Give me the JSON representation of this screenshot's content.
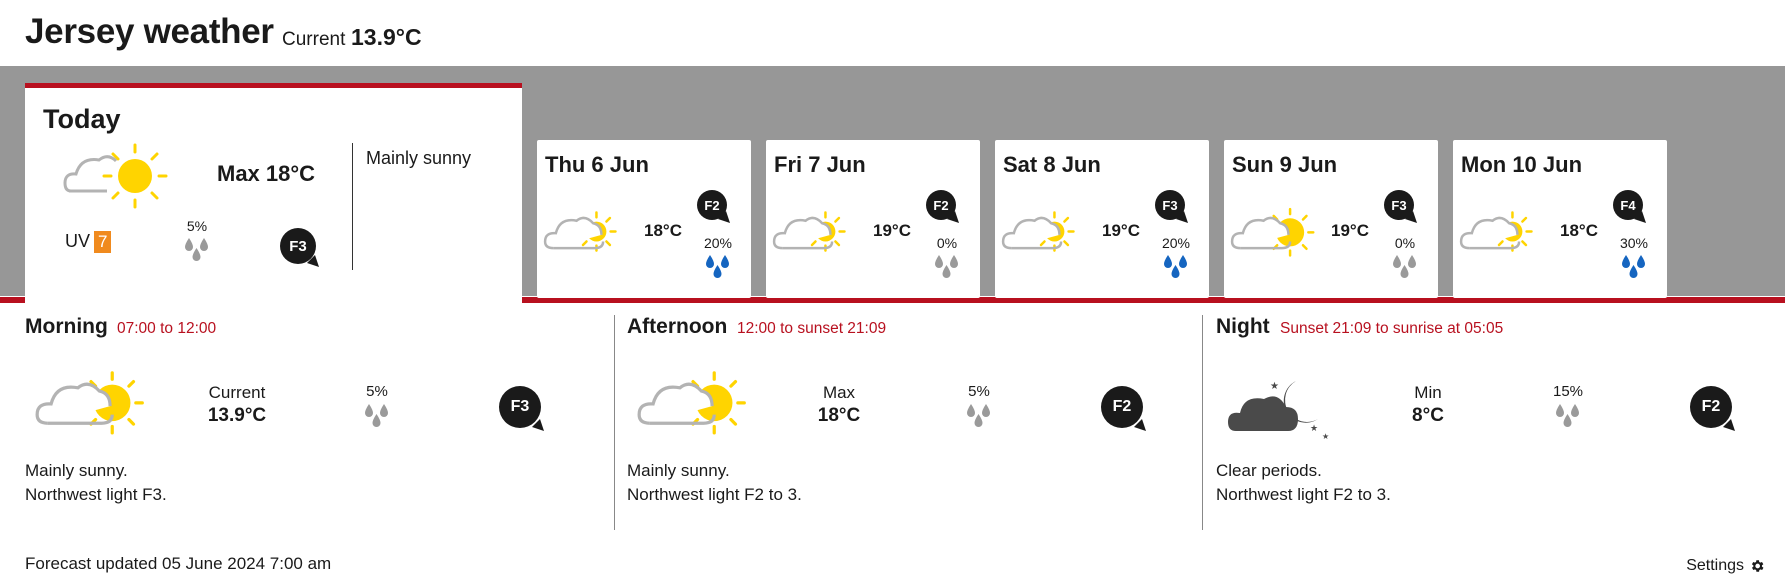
{
  "header": {
    "title": "Jersey weather",
    "current_label": "Current",
    "current_value": "13.9°C"
  },
  "today": {
    "title": "Today",
    "icon": "cloud-sun-icon",
    "max": "Max 18°C",
    "uv_label": "UV",
    "uv_value": "7",
    "rain": "5%",
    "wind": "F3",
    "summary": "Mainly sunny"
  },
  "days": [
    {
      "name": "Thu 6 Jun",
      "temp": "18°C",
      "rain": "20%",
      "wind": "F2",
      "icon": "cloud-sun-icon"
    },
    {
      "name": "Fri 7 Jun",
      "temp": "19°C",
      "rain": "0%",
      "wind": "F2",
      "icon": "cloud-sun-icon"
    },
    {
      "name": "Sat 8 Jun",
      "temp": "19°C",
      "rain": "20%",
      "wind": "F3",
      "icon": "cloud-sun-icon"
    },
    {
      "name": "Sun 9 Jun",
      "temp": "19°C",
      "rain": "0%",
      "wind": "F3",
      "icon": "sun-cloud-icon"
    },
    {
      "name": "Mon 10 Jun",
      "temp": "18°C",
      "rain": "30%",
      "wind": "F4",
      "icon": "cloud-sun-icon"
    }
  ],
  "periods": [
    {
      "title": "Morning",
      "time": "07:00 to 12:00",
      "label": "Current",
      "value": "13.9°C",
      "rain": "5%",
      "wind": "F3",
      "desc1": "Mainly sunny.",
      "desc2": "Northwest light F3.",
      "icon": "cloud-sun-icon"
    },
    {
      "title": "Afternoon",
      "time": "12:00 to sunset 21:09",
      "label": "Max",
      "value": "18°C",
      "rain": "5%",
      "wind": "F2",
      "desc1": "Mainly sunny.",
      "desc2": "Northwest light F2 to 3.",
      "icon": "cloud-sun-icon"
    },
    {
      "title": "Night",
      "time": "Sunset 21:09 to sunrise at 05:05",
      "label": "Min",
      "value": "8°C",
      "rain": "15%",
      "wind": "F2",
      "desc1": "Clear periods.",
      "desc2": "Northwest light F2 to 3.",
      "icon": "cloud-moon-icon"
    }
  ],
  "footer": {
    "updated": "Forecast updated 05 June 2024 7:00 am",
    "settings": "Settings",
    "settings_icon": "gear-icon"
  },
  "colors": {
    "accent_red": "#b8101f",
    "band_grey": "#979797",
    "uv_orange": "#f08a1e",
    "sun_yellow": "#ffd400",
    "drop_blue": "#1565c0",
    "drop_grey": "#9a9a9a"
  }
}
